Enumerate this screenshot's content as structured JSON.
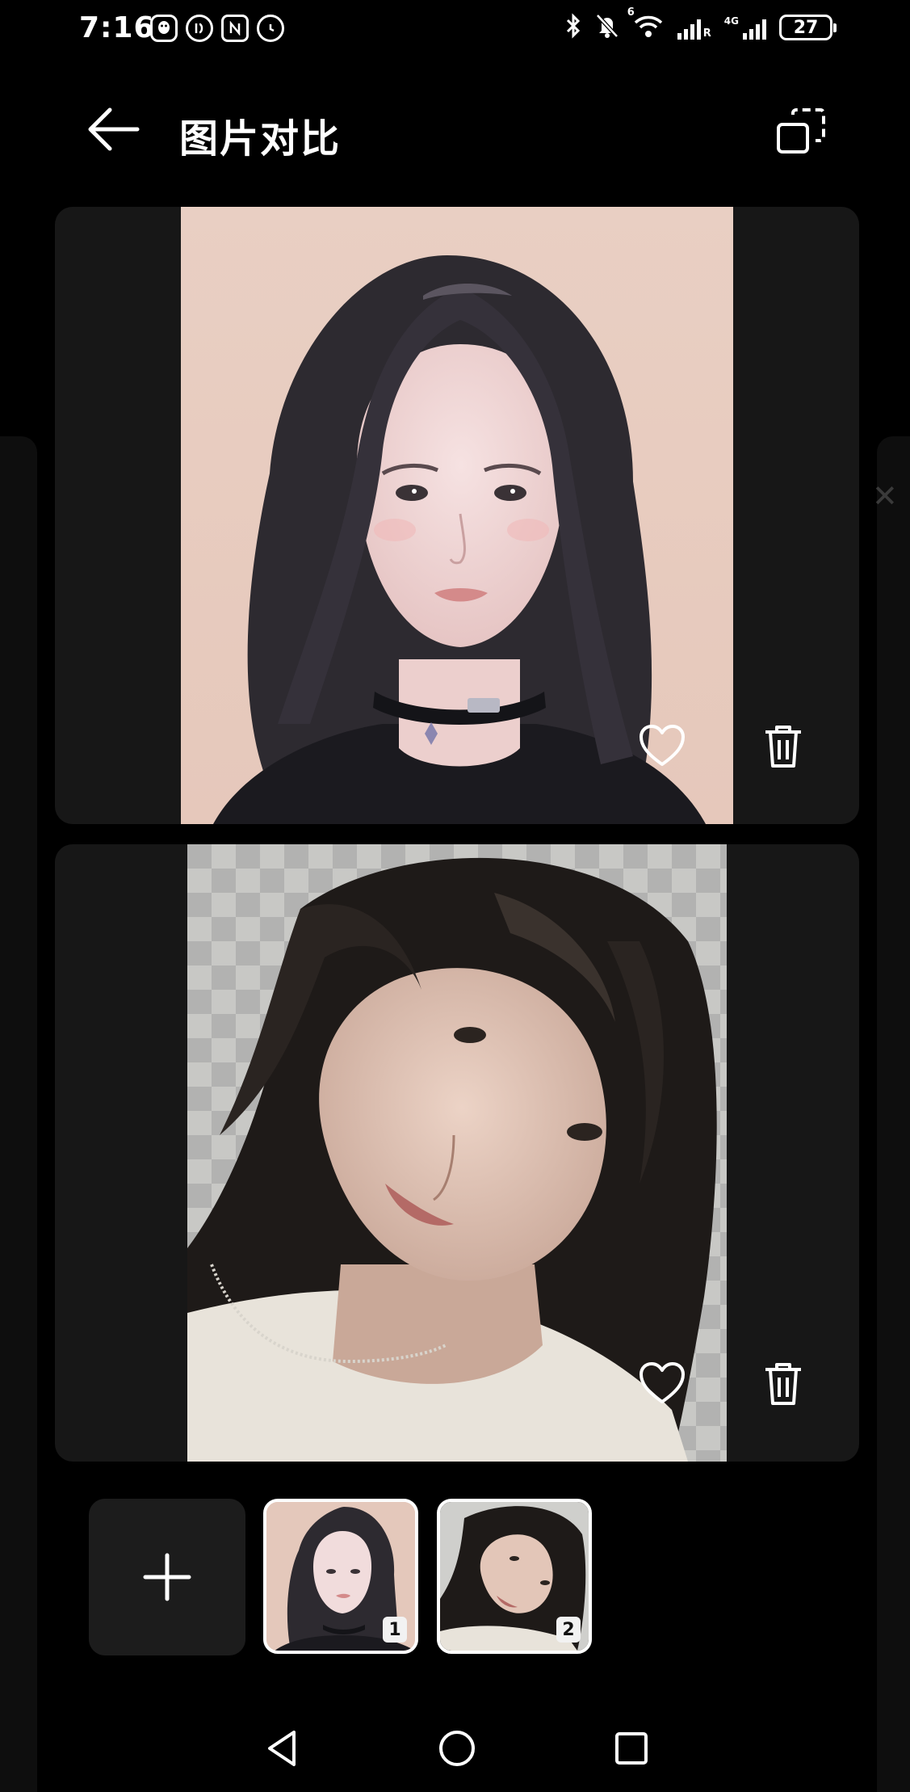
{
  "status_bar": {
    "time": "7:16",
    "left_icons": [
      "qq-icon",
      "data-saver-icon",
      "nfc-icon",
      "alarm-icon"
    ],
    "right_icons": [
      "bluetooth-icon",
      "mute-icon",
      "wifi-icon",
      "signal-icon",
      "signal-4g-icon"
    ],
    "signal_labels": {
      "sim1": "R",
      "sim2": "4G",
      "wifi": "6"
    },
    "battery_level": "27"
  },
  "header": {
    "title": "图片对比",
    "back_icon": "arrow-left-icon",
    "layout_icon": "layout-switch-icon"
  },
  "photos": [
    {
      "index": 1,
      "description_icon": "portrait-rendered",
      "actions": [
        "favorite-icon",
        "delete-icon"
      ]
    },
    {
      "index": 2,
      "description_icon": "portrait-photo",
      "actions": [
        "favorite-icon",
        "delete-icon"
      ]
    }
  ],
  "tray": {
    "add_icon": "plus-icon",
    "thumbs": [
      {
        "badge": "1"
      },
      {
        "badge": "2"
      }
    ]
  },
  "nav": {
    "back": "triangle-back-icon",
    "home": "circle-home-icon",
    "recent": "square-recent-icon"
  },
  "colors": {
    "background": "#000000",
    "card": "#171717",
    "tray_button": "#1c1c1c",
    "text": "#ffffff"
  }
}
